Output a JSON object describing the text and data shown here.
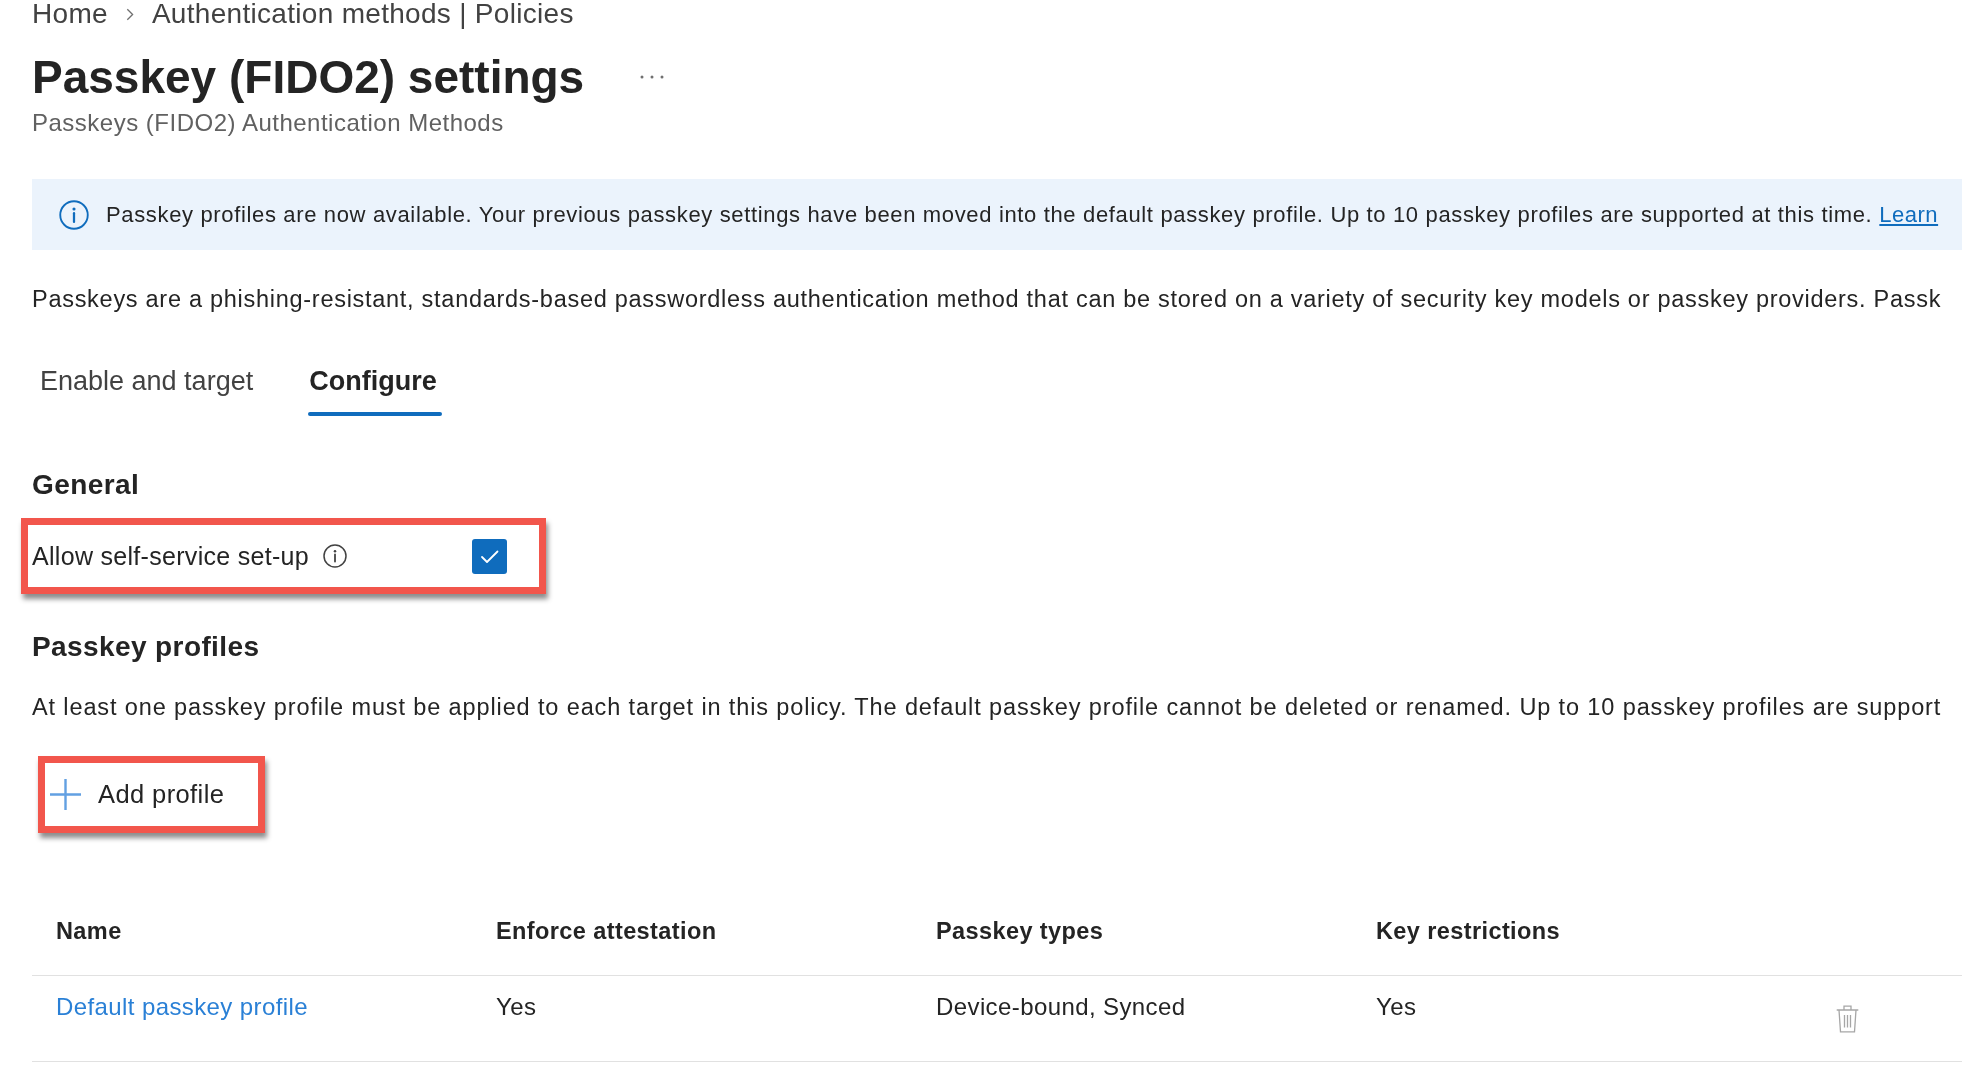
{
  "breadcrumb": [
    {
      "label": "Home"
    },
    {
      "label": "Authentication methods | Policies"
    }
  ],
  "header": {
    "title": "Passkey (FIDO2) settings",
    "subtitle": "Passkeys (FIDO2) Authentication Methods"
  },
  "banner": {
    "message": "Passkey profiles are now available. Your previous passkey settings have been moved into the default passkey profile. Up to 10 passkey profiles are supported at this time.",
    "link": "Learn"
  },
  "description": "Passkeys are a phishing-resistant, standards-based passwordless authentication method that can be stored on a variety of security key models or passkey providers. Passk",
  "tabs": [
    {
      "label": "Enable and target",
      "selected": false
    },
    {
      "label": "Configure",
      "selected": true
    }
  ],
  "general": {
    "heading": "General",
    "settings": [
      {
        "label": "Allow self-service set-up",
        "checked": true,
        "highlighted": true
      }
    ]
  },
  "passkey_profiles": {
    "heading": "Passkey profiles",
    "description": "At least one passkey profile must be applied to each target in this policy. The default passkey profile cannot be deleted or renamed. Up to 10 passkey profiles are support",
    "add_button": {
      "label": "Add profile",
      "highlighted": true
    },
    "table": {
      "columns": [
        "Name",
        "Enforce attestation",
        "Passkey types",
        "Key restrictions"
      ],
      "rows": [
        {
          "cells": [
            "Default passkey profile",
            "Yes",
            "Device-bound, Synced",
            "Yes"
          ],
          "delete_disabled": true
        }
      ]
    }
  }
}
